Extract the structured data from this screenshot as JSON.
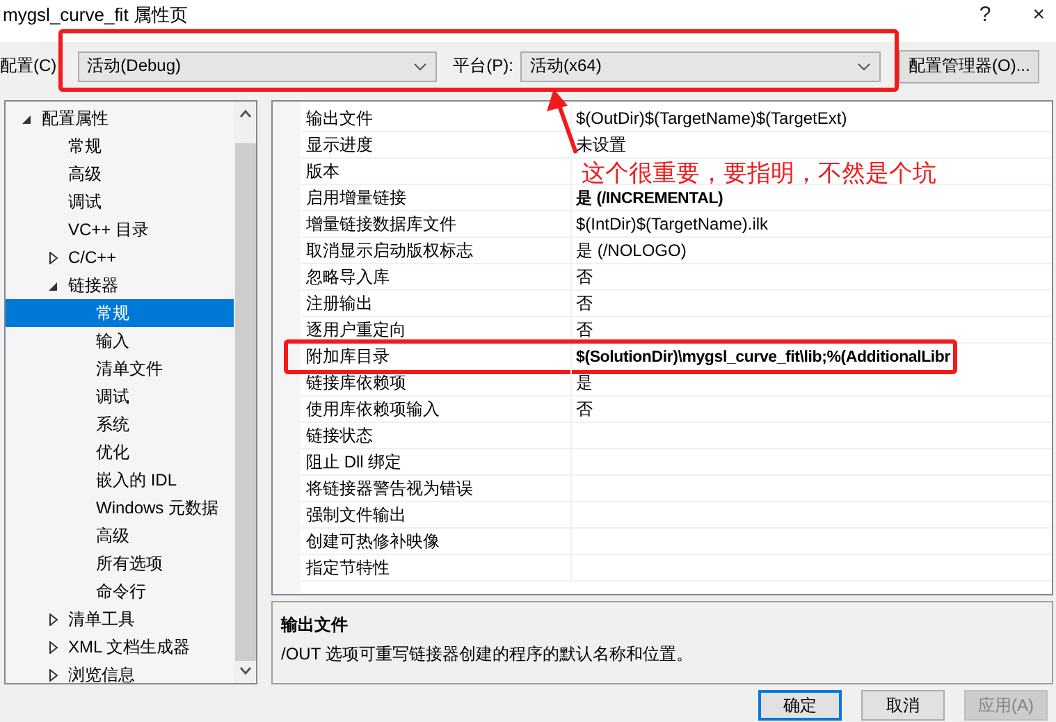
{
  "window": {
    "title": "mygsl_curve_fit 属性页",
    "help": "?",
    "close": "×"
  },
  "config_bar": {
    "highlighted": true,
    "config_label": "配置(C)",
    "config_value": "活动(Debug)",
    "platform_label": "平台(P):",
    "platform_value": "活动(x64)",
    "manager_button": "配置管理器(O)..."
  },
  "tree": [
    {
      "label": "配置属性",
      "selected": false,
      "expanded": true,
      "children": [
        {
          "label": "常规",
          "selected": false
        },
        {
          "label": "高级",
          "selected": false
        },
        {
          "label": "调试",
          "selected": false
        },
        {
          "label": "VC++ 目录",
          "selected": false
        },
        {
          "label": "C/C++",
          "selected": false,
          "expanded": false
        },
        {
          "label": "链接器",
          "selected": false,
          "expanded": true,
          "children": [
            {
              "label": "常规",
              "selected": true
            },
            {
              "label": "输入",
              "selected": false
            },
            {
              "label": "清单文件",
              "selected": false
            },
            {
              "label": "调试",
              "selected": false
            },
            {
              "label": "系统",
              "selected": false
            },
            {
              "label": "优化",
              "selected": false
            },
            {
              "label": "嵌入的 IDL",
              "selected": false
            },
            {
              "label": "Windows 元数据",
              "selected": false
            },
            {
              "label": "高级",
              "selected": false
            },
            {
              "label": "所有选项",
              "selected": false
            },
            {
              "label": "命令行",
              "selected": false
            }
          ]
        },
        {
          "label": "清单工具",
          "selected": false,
          "expanded": false
        },
        {
          "label": "XML 文档生成器",
          "selected": false,
          "expanded": false
        },
        {
          "label": "浏览信息",
          "selected": false,
          "expanded": false
        }
      ]
    }
  ],
  "properties": [
    {
      "name": "输出文件",
      "value": "$(OutDir)$(TargetName)$(TargetExt)",
      "bold": false,
      "highlighted": false
    },
    {
      "name": "显示进度",
      "value": "未设置",
      "bold": false,
      "highlighted": false
    },
    {
      "name": "版本",
      "highlighted": false
    },
    {
      "name": "启用增量链接",
      "value": "是 (/INCREMENTAL)",
      "bold": true,
      "highlighted": false
    },
    {
      "name": "增量链接数据库文件",
      "value": "$(IntDir)$(TargetName).ilk",
      "bold": false,
      "highlighted": false
    },
    {
      "name": "取消显示启动版权标志",
      "value": "是 (/NOLOGO)",
      "bold": false,
      "highlighted": false
    },
    {
      "name": "忽略导入库",
      "value": "否",
      "bold": false,
      "highlighted": false
    },
    {
      "name": "注册输出",
      "value": "否",
      "bold": false,
      "highlighted": false
    },
    {
      "name": "逐用户重定向",
      "value": "否",
      "bold": false,
      "highlighted": false
    },
    {
      "name": "附加库目录",
      "value": "$(SolutionDir)\\mygsl_curve_fit\\lib;%(AdditionalLibr",
      "bold": true,
      "highlighted": true
    },
    {
      "name": "链接库依赖项",
      "value": "是",
      "bold": false,
      "highlighted": false
    },
    {
      "name": "使用库依赖项输入",
      "value": "否",
      "bold": false,
      "highlighted": false
    },
    {
      "name": "链接状态",
      "highlighted": false
    },
    {
      "name": "阻止 Dll 绑定",
      "highlighted": false
    },
    {
      "name": "将链接器警告视为错误",
      "highlighted": false
    },
    {
      "name": "强制文件输出",
      "highlighted": false
    },
    {
      "name": "创建可热修补映像",
      "highlighted": false
    },
    {
      "name": "指定节特性",
      "highlighted": false
    }
  ],
  "description": {
    "title": "输出文件",
    "text": "/OUT 选项可重写链接器创建的程序的默认名称和位置。"
  },
  "annotation": {
    "text": "这个很重要，要指明，不然是个坑"
  },
  "buttons": [
    {
      "label": "确定",
      "default": true,
      "disabled": false
    },
    {
      "label": "取消",
      "default": false,
      "disabled": false
    },
    {
      "label": "应用(A)",
      "default": false,
      "disabled": true
    }
  ]
}
